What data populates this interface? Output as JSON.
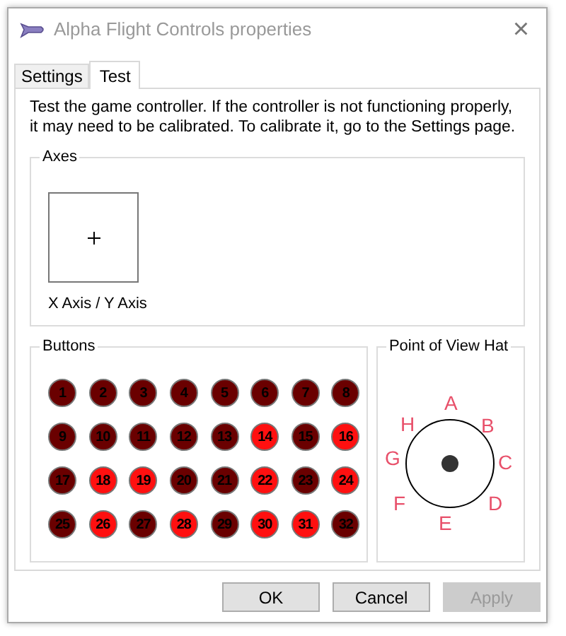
{
  "window": {
    "title": "Alpha Flight Controls properties",
    "close": "×"
  },
  "tabs": [
    {
      "label": "Settings",
      "selected": false
    },
    {
      "label": "Test",
      "selected": true
    }
  ],
  "intro": "Test the game controller.  If the controller is not functioning properly, it may need to be calibrated.  To calibrate it, go to the Settings page.",
  "axes": {
    "title": "Axes",
    "label": "X Axis / Y Axis"
  },
  "buttons": {
    "title": "Buttons",
    "items": [
      {
        "label": "1",
        "pressed": false
      },
      {
        "label": "2",
        "pressed": false
      },
      {
        "label": "3",
        "pressed": false
      },
      {
        "label": "4",
        "pressed": false
      },
      {
        "label": "5",
        "pressed": false
      },
      {
        "label": "6",
        "pressed": false
      },
      {
        "label": "7",
        "pressed": false
      },
      {
        "label": "8",
        "pressed": false
      },
      {
        "label": "9",
        "pressed": false
      },
      {
        "label": "10",
        "pressed": false
      },
      {
        "label": "11",
        "pressed": false
      },
      {
        "label": "12",
        "pressed": false
      },
      {
        "label": "13",
        "pressed": false
      },
      {
        "label": "14",
        "pressed": true
      },
      {
        "label": "15",
        "pressed": false
      },
      {
        "label": "16",
        "pressed": true
      },
      {
        "label": "17",
        "pressed": false
      },
      {
        "label": "18",
        "pressed": true
      },
      {
        "label": "19",
        "pressed": true
      },
      {
        "label": "20",
        "pressed": false
      },
      {
        "label": "21",
        "pressed": false
      },
      {
        "label": "22",
        "pressed": true
      },
      {
        "label": "23",
        "pressed": false
      },
      {
        "label": "24",
        "pressed": true
      },
      {
        "label": "25",
        "pressed": false
      },
      {
        "label": "26",
        "pressed": true
      },
      {
        "label": "27",
        "pressed": false
      },
      {
        "label": "28",
        "pressed": true
      },
      {
        "label": "29",
        "pressed": false
      },
      {
        "label": "30",
        "pressed": true
      },
      {
        "label": "31",
        "pressed": true
      },
      {
        "label": "32",
        "pressed": false
      }
    ]
  },
  "pov": {
    "title": "Point of View Hat",
    "directions": [
      "A",
      "B",
      "C",
      "D",
      "E",
      "F",
      "G",
      "H"
    ]
  },
  "footer": [
    {
      "label": "OK",
      "disabled": false
    },
    {
      "label": "Cancel",
      "disabled": false
    },
    {
      "label": "Apply",
      "disabled": true
    }
  ]
}
